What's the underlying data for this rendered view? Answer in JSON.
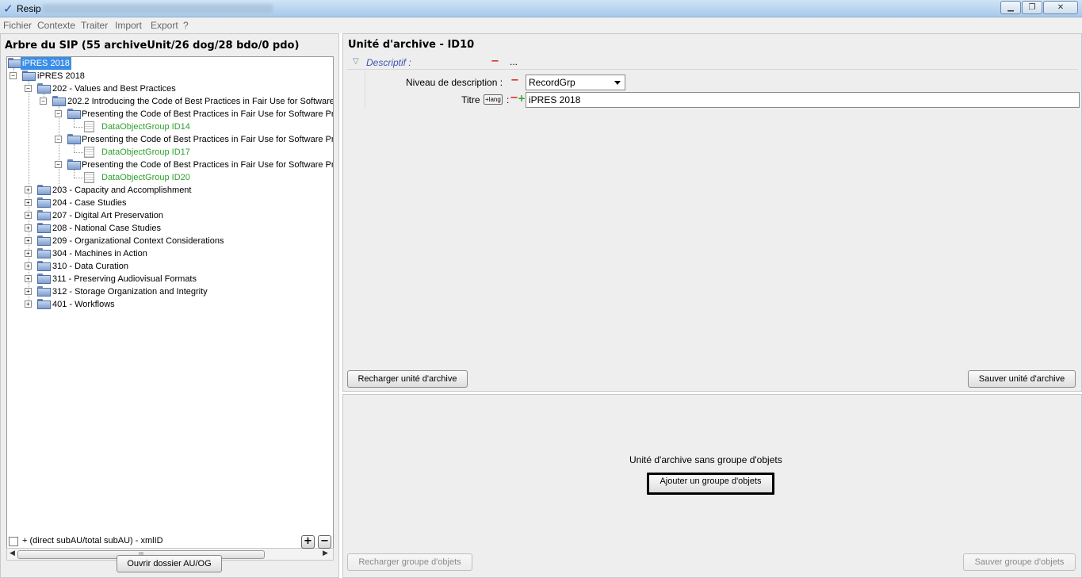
{
  "window": {
    "title": "Resip",
    "controls": [
      "minimize",
      "restore",
      "close"
    ]
  },
  "menu": [
    "Fichier",
    "Contexte",
    "Traiter",
    "Import",
    "Export",
    "?"
  ],
  "left_panel": {
    "title": "Arbre du SIP (55 archiveUnit/26 dog/28 bdo/0 pdo)",
    "tree": [
      {
        "label": "iPRES 2018",
        "kind": "folder",
        "selected": true
      },
      {
        "label": "iPRES 2018",
        "kind": "folder"
      },
      {
        "label": "202 - Values and Best Practices",
        "kind": "folder"
      },
      {
        "label": "202.2 Introducing the Code of Best Practices in Fair Use for Software",
        "kind": "folder"
      },
      {
        "label": "Presenting the Code of Best Practices in Fair Use for Software Pre",
        "kind": "folder"
      },
      {
        "label": "DataObjectGroup ID14",
        "kind": "dog"
      },
      {
        "label": "Presenting the Code of Best Practices in Fair Use for Software Pre",
        "kind": "folder"
      },
      {
        "label": "DataObjectGroup ID17",
        "kind": "dog"
      },
      {
        "label": "Presenting the Code of Best Practices in Fair Use for Software Pre",
        "kind": "folder"
      },
      {
        "label": "DataObjectGroup ID20",
        "kind": "dog"
      },
      {
        "label": "203 - Capacity and Accomplishment",
        "kind": "folder"
      },
      {
        "label": "204 - Case Studies",
        "kind": "folder"
      },
      {
        "label": "207 - Digital Art Preservation",
        "kind": "folder"
      },
      {
        "label": "208 - National Case Studies",
        "kind": "folder"
      },
      {
        "label": "209 - Organizational Context Considerations",
        "kind": "folder"
      },
      {
        "label": "304 - Machines in Action",
        "kind": "folder"
      },
      {
        "label": "310 - Data Curation",
        "kind": "folder"
      },
      {
        "label": "311 - Preserving Audiovisual Formats",
        "kind": "folder"
      },
      {
        "label": "312 - Storage Organization and Integrity",
        "kind": "folder"
      },
      {
        "label": "401 - Workflows",
        "kind": "folder"
      }
    ],
    "scroll_thumb_text": "III",
    "checkbox_label": "+ (direct subAU/total subAU) - xmlID",
    "plus_btn": "+",
    "minus_btn": "−",
    "open_button": "Ouvrir dossier AU/OG"
  },
  "archive_unit": {
    "title": "Unité d'archive - ID10",
    "title_more": "...",
    "section_label": "Descriptif :",
    "section_minus": "−",
    "section_more": "...",
    "level_label": "Niveau de description :",
    "level_value": "RecordGrp",
    "title_field_label": "Titre",
    "lang_button": "+lang",
    "title_field_suffix": ":",
    "title_value": "iPRES 2018",
    "reload_button": "Recharger unité d'archive",
    "save_button": "Sauver unité d'archive"
  },
  "object_group": {
    "message": "Unité d'archive sans groupe d'objets",
    "add_button": "Ajouter un groupe d'objets",
    "reload_button": "Recharger groupe d'objets",
    "save_button": "Sauver groupe d'objets"
  },
  "colors": {
    "selection": "#3a8ee6",
    "dog_text": "#2ea02e",
    "remove": "#e0221a",
    "add": "#2ea02e",
    "section_label": "#3a55b4"
  }
}
